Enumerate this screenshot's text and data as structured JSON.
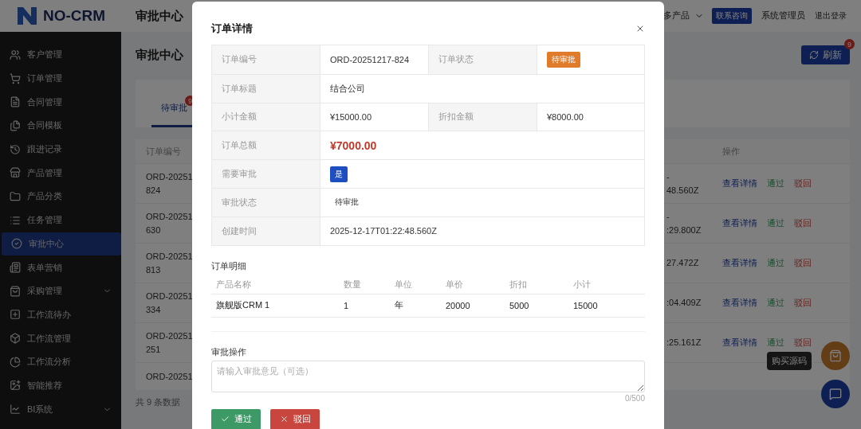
{
  "header": {
    "logo_text": "NO-CRM",
    "title": "审批中心",
    "menu": "多产品",
    "contact_button": "联系咨询",
    "user": "系统管理员",
    "logout": "退出登录"
  },
  "sidebar": {
    "items": [
      {
        "label": "客户管理",
        "selected": false,
        "expandable": false
      },
      {
        "label": "订单管理",
        "selected": false,
        "expandable": false
      },
      {
        "label": "合同管理",
        "selected": false,
        "expandable": false
      },
      {
        "label": "合同模板",
        "selected": false,
        "expandable": false
      },
      {
        "label": "跟进记录",
        "selected": false,
        "expandable": false
      },
      {
        "label": "产品管理",
        "selected": false,
        "expandable": false
      },
      {
        "label": "产品分类",
        "selected": false,
        "expandable": false
      },
      {
        "label": "任务管理",
        "selected": false,
        "expandable": false
      },
      {
        "label": "审批中心",
        "selected": true,
        "expandable": false
      },
      {
        "label": "表单营销",
        "selected": false,
        "expandable": false
      },
      {
        "label": "采购管理",
        "selected": false,
        "expandable": true
      },
      {
        "label": "工作流待办",
        "selected": false,
        "expandable": false
      },
      {
        "label": "工作流管理",
        "selected": false,
        "expandable": false
      },
      {
        "label": "工作流分析",
        "selected": false,
        "expandable": false
      },
      {
        "label": "智能推荐",
        "selected": false,
        "expandable": false
      },
      {
        "label": "BI系统",
        "selected": false,
        "expandable": true
      }
    ]
  },
  "main": {
    "title": "审批中心",
    "refresh_button": {
      "label": "刷新",
      "badge": "9"
    },
    "tabs": [
      {
        "label": "待审批",
        "selected": true,
        "badge": "9"
      }
    ],
    "table": {
      "columns": [
        "订单编号",
        "操作"
      ],
      "rows": [
        {
          "order_no": [
            "ORD-20251",
            "824"
          ],
          "time": [
            "-",
            "48.560Z"
          ],
          "actions": [
            {
              "label": "查看详情",
              "kind": "view"
            },
            {
              "label": "通过",
              "kind": "approve"
            },
            {
              "label": "驳回",
              "kind": "reject"
            }
          ]
        },
        {
          "order_no": [
            "ORD-20251",
            "630"
          ],
          "time": [
            "-",
            ":29.800Z"
          ],
          "actions": [
            {
              "label": "查看详情",
              "kind": "view"
            },
            {
              "label": "通过",
              "kind": "approve"
            },
            {
              "label": "驳回",
              "kind": "reject"
            }
          ]
        },
        {
          "order_no": [
            "ORD-20251",
            "813"
          ],
          "time": [
            "27.472Z"
          ],
          "actions": [
            {
              "label": "查看详情",
              "kind": "view"
            },
            {
              "label": "通过",
              "kind": "approve"
            },
            {
              "label": "驳回",
              "kind": "reject"
            }
          ]
        },
        {
          "order_no": [
            "ORD-20251",
            "334"
          ],
          "time": [
            ":04.409Z"
          ],
          "actions": [
            {
              "label": "查看详情",
              "kind": "view"
            },
            {
              "label": "通过",
              "kind": "approve"
            },
            {
              "label": "驳回",
              "kind": "reject"
            }
          ]
        },
        {
          "order_no": [
            "ORD-20251",
            "251"
          ],
          "time": [
            ":25.161Z"
          ],
          "actions": [
            {
              "label": "查看详情",
              "kind": "view"
            },
            {
              "label": "通过",
              "kind": "approve"
            },
            {
              "label": "驳回",
              "kind": "reject"
            }
          ]
        },
        {
          "order_no": [
            "ORD-20251"
          ],
          "time": [],
          "actions": []
        }
      ]
    },
    "footer": "共 9 条数据"
  },
  "floating": {
    "tooltip": "购买源码"
  },
  "modal": {
    "title": "订单详情",
    "details": [
      [
        {
          "label": "订单编号",
          "value": "ORD-20251217-824",
          "kind": "text"
        },
        {
          "label": "订单状态",
          "value": "待审批",
          "kind": "tag-warning"
        }
      ],
      [
        {
          "label": "订单标题",
          "value": "结合公司",
          "kind": "text"
        }
      ],
      [
        {
          "label": "小计金额",
          "value": "¥15000.00",
          "kind": "text"
        },
        {
          "label": "折扣金额",
          "value": "¥8000.00",
          "kind": "text"
        }
      ],
      [
        {
          "label": "订单总额",
          "value": "¥7000.00",
          "kind": "amount"
        }
      ],
      [
        {
          "label": "需要审批",
          "value": "是",
          "kind": "tag-primary"
        }
      ],
      [
        {
          "label": "审批状态",
          "value": "待审批",
          "kind": "tag-plain"
        }
      ],
      [
        {
          "label": "创建时间",
          "value": "2025-12-17T01:22:48.560Z",
          "kind": "text"
        }
      ]
    ],
    "items_title": "订单明细",
    "items": {
      "columns": [
        "产品名称",
        "数量",
        "单位",
        "单价",
        "折扣",
        "小计"
      ],
      "rows": [
        [
          "旗舰版CRM 1",
          "1",
          "年",
          "20000",
          "5000",
          "15000"
        ]
      ]
    },
    "approval": {
      "title": "审批操作",
      "placeholder": "请输入审批意见（可选）",
      "counter": "0/500",
      "buttons": [
        {
          "label": "通过",
          "kind": "approve"
        },
        {
          "label": "驳回",
          "kind": "reject"
        }
      ]
    }
  }
}
